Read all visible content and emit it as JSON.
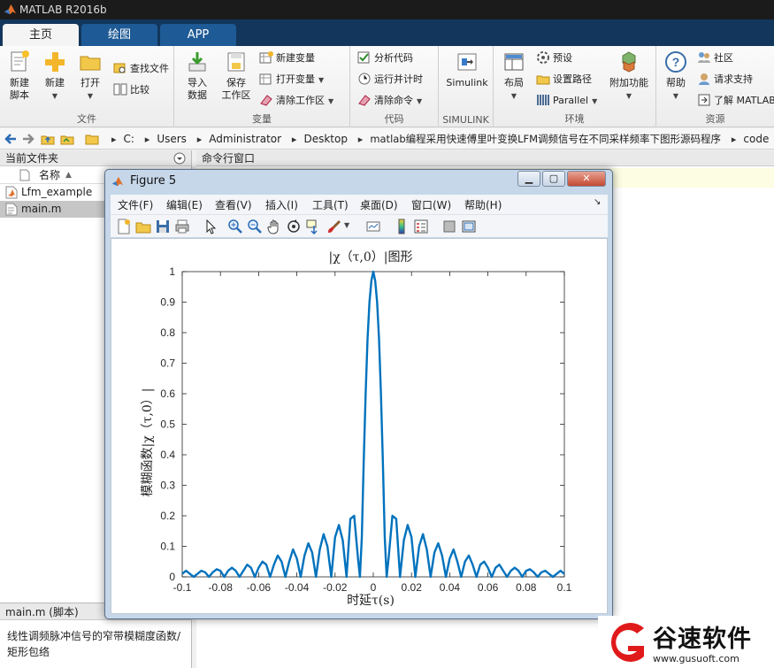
{
  "app": {
    "title": "MATLAB R2016b"
  },
  "tabs": [
    {
      "label": "主页",
      "active": true
    },
    {
      "label": "绘图",
      "active": false
    },
    {
      "label": "APP",
      "active": false
    }
  ],
  "ribbon": {
    "file": {
      "group_label": "文件",
      "new_script": "新建\n脚本",
      "new": "新建",
      "open": "打开",
      "find_files": "查找文件",
      "compare": "比较"
    },
    "variable": {
      "group_label": "变量",
      "import_data": "导入\n数据",
      "save_workspace": "保存\n工作区",
      "new_variable": "新建变量",
      "open_variable": "打开变量",
      "clear_workspace": "清除工作区"
    },
    "code": {
      "group_label": "代码",
      "analyze_code": "分析代码",
      "run_and_time": "运行并计时",
      "clear_commands": "清除命令"
    },
    "simulink": {
      "group_label": "SIMULINK",
      "simulink": "Simulink"
    },
    "environment": {
      "group_label": "环境",
      "layout": "布局",
      "preferences": "预设",
      "set_path": "设置路径",
      "parallel": "Parallel",
      "add_ons": "附加功能"
    },
    "resources": {
      "group_label": "资源",
      "help": "帮助",
      "community": "社区",
      "request_support": "请求支持",
      "learn_matlab": "了解 MATLAB"
    }
  },
  "address": {
    "crumbs": [
      "C:",
      "Users",
      "Administrator",
      "Desktop",
      "matlab编程采用快速傅里叶变换LFM调频信号在不同采样频率下图形源码程序",
      "code"
    ]
  },
  "left_panel": {
    "title": "当前文件夹",
    "column_name": "名称",
    "sort_indicator": "▲",
    "files": [
      {
        "name": "Lfm_example",
        "selected": false
      },
      {
        "name": "main.m",
        "selected": true
      }
    ],
    "details_header": "main.m  (脚本)",
    "details_description": "线性调频脉冲信号的窄带模糊度函数/矩形包络"
  },
  "command_window": {
    "title": "命令行窗口"
  },
  "figure": {
    "title": "Figure 5",
    "menu": [
      "文件(F)",
      "编辑(E)",
      "查看(V)",
      "插入(I)",
      "工具(T)",
      "桌面(D)",
      "窗口(W)",
      "帮助(H)"
    ],
    "toolbar_icons": [
      "new-figure-icon",
      "open-file-icon",
      "save-icon",
      "print-icon",
      "pointer-icon",
      "zoom-in-icon",
      "zoom-out-icon",
      "pan-icon",
      "rotate-icon",
      "data-cursor-icon",
      "brush-icon",
      "link-plot-icon",
      "colorbar-icon",
      "legend-icon",
      "hide-plot-tools-icon",
      "show-plot-tools-icon"
    ]
  },
  "chart_data": {
    "type": "line",
    "title": "|χ（τ,0）|图形",
    "xlabel": "时延τ(s)",
    "ylabel": "模糊函数|χ（τ,0）|",
    "xlim": [
      -0.1,
      0.1
    ],
    "ylim": [
      0,
      1
    ],
    "xticks": [
      "-0.1",
      "-0.08",
      "-0.06",
      "-0.04",
      "-0.02",
      "0",
      "0.02",
      "0.04",
      "0.06",
      "0.08",
      "0.1"
    ],
    "yticks": [
      "0",
      "0.1",
      "0.2",
      "0.3",
      "0.4",
      "0.5",
      "0.6",
      "0.7",
      "0.8",
      "0.9",
      "1"
    ],
    "grid": false,
    "line_color": "#0072bd",
    "series": [
      {
        "x": [
          -0.1,
          -0.098,
          -0.096,
          -0.094,
          -0.092,
          -0.09,
          -0.088,
          -0.086,
          -0.084,
          -0.082,
          -0.08,
          -0.078,
          -0.076,
          -0.074,
          -0.072,
          -0.07,
          -0.068,
          -0.066,
          -0.064,
          -0.062,
          -0.06,
          -0.058,
          -0.056,
          -0.054,
          -0.052,
          -0.05,
          -0.048,
          -0.046,
          -0.044,
          -0.042,
          -0.04,
          -0.038,
          -0.036,
          -0.034,
          -0.032,
          -0.03,
          -0.028,
          -0.026,
          -0.024,
          -0.022,
          -0.02,
          -0.018,
          -0.016,
          -0.014,
          -0.012,
          -0.01,
          -0.008,
          -0.007,
          -0.006,
          -0.005,
          -0.004,
          -0.003,
          -0.002,
          -0.001,
          0,
          0.001,
          0.002,
          0.003,
          0.004,
          0.005,
          0.006,
          0.007,
          0.008,
          0.01,
          0.012,
          0.014,
          0.016,
          0.018,
          0.02,
          0.022,
          0.024,
          0.026,
          0.028,
          0.03,
          0.032,
          0.034,
          0.036,
          0.038,
          0.04,
          0.042,
          0.044,
          0.046,
          0.048,
          0.05,
          0.052,
          0.054,
          0.056,
          0.058,
          0.06,
          0.062,
          0.064,
          0.066,
          0.068,
          0.07,
          0.072,
          0.074,
          0.076,
          0.078,
          0.08,
          0.082,
          0.084,
          0.086,
          0.088,
          0.09,
          0.092,
          0.094,
          0.096,
          0.098,
          0.1
        ],
        "y": [
          0.01,
          0.02,
          0.01,
          0.0,
          0.01,
          0.02,
          0.015,
          0.0,
          0.015,
          0.025,
          0.02,
          0.0,
          0.02,
          0.03,
          0.02,
          0.0,
          0.02,
          0.04,
          0.03,
          0.0,
          0.03,
          0.05,
          0.04,
          0.0,
          0.04,
          0.07,
          0.05,
          0.0,
          0.05,
          0.09,
          0.06,
          0.0,
          0.07,
          0.11,
          0.08,
          0.0,
          0.09,
          0.14,
          0.1,
          0.0,
          0.13,
          0.17,
          0.12,
          0.0,
          0.19,
          0.2,
          0.06,
          0.0,
          0.13,
          0.38,
          0.6,
          0.78,
          0.9,
          0.97,
          1.0,
          0.97,
          0.9,
          0.78,
          0.6,
          0.38,
          0.13,
          0.0,
          0.06,
          0.2,
          0.19,
          0.0,
          0.12,
          0.17,
          0.13,
          0.0,
          0.1,
          0.14,
          0.09,
          0.0,
          0.08,
          0.11,
          0.07,
          0.0,
          0.06,
          0.09,
          0.05,
          0.0,
          0.05,
          0.07,
          0.04,
          0.0,
          0.04,
          0.05,
          0.03,
          0.0,
          0.03,
          0.04,
          0.02,
          0.0,
          0.02,
          0.03,
          0.02,
          0.0,
          0.02,
          0.025,
          0.015,
          0.0,
          0.015,
          0.02,
          0.01,
          0.0,
          0.01,
          0.02,
          0.01
        ]
      }
    ]
  },
  "watermark": {
    "brand": "谷速软件",
    "url": "www.gusuoft.com"
  }
}
